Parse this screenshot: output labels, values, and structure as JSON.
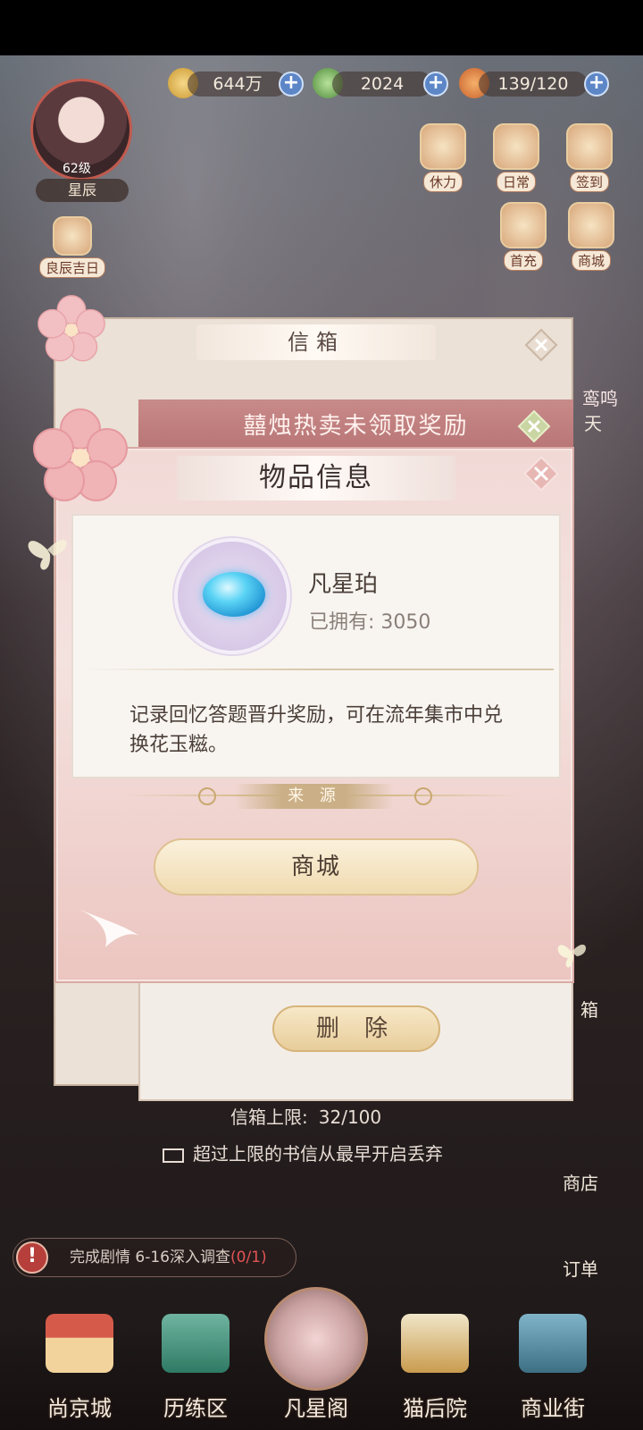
{
  "status_bar": {
    "coins": "644万",
    "gems": "2024",
    "stamina": "139/120"
  },
  "player": {
    "level": "62级",
    "name": "星辰"
  },
  "side_buttons": {
    "stamina": "休力",
    "daily": "日常",
    "checkin": "签到",
    "first_recharge": "首充",
    "mall": "商城",
    "lucky_day": "良辰吉日"
  },
  "mailbox": {
    "title": "信箱",
    "letter_title": "囍烛热卖未领取奖励",
    "delete_label": "删 除",
    "limit_label": "信箱上限:",
    "limit_value": "32/100",
    "discard_note": "超过上限的书信从最早开启丢弃"
  },
  "item_info": {
    "title": "物品信息",
    "item_name": "凡星珀",
    "owned_label": "已拥有:",
    "owned_count": "3050",
    "description": "记录回忆答题晋升奖励，可在流年集市中兑换花玉糍。",
    "source_label": "来 源",
    "source_button": "商城"
  },
  "right_edge": {
    "luanming": "鸾鸣",
    "tian": "天",
    "xiang": "箱",
    "shop": "商店",
    "order": "订单"
  },
  "task": {
    "alert": "!",
    "text": "完成剧情 6-16深入调查",
    "progress": "(0/1)"
  },
  "bottom_nav": [
    {
      "label": "尚京城"
    },
    {
      "label": "历练区"
    },
    {
      "label": "凡星阁"
    },
    {
      "label": "猫后院"
    },
    {
      "label": "商业街"
    }
  ],
  "colors": {
    "gem_blue": "#1b8ed0",
    "accent_pink": "#d9aaa3",
    "alert_red": "#b63f3b"
  }
}
